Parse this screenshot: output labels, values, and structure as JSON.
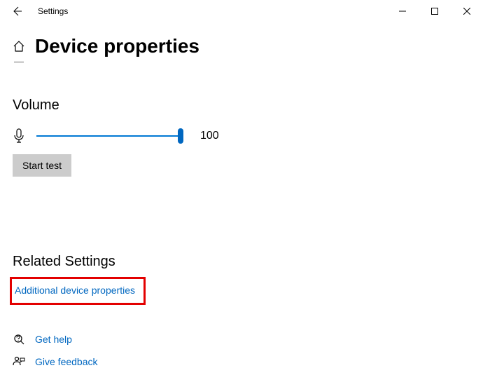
{
  "titlebar": {
    "app_title": "Settings"
  },
  "header": {
    "page_title": "Device properties"
  },
  "volume": {
    "section_title": "Volume",
    "value": "100",
    "start_test_label": "Start test"
  },
  "related": {
    "title": "Related Settings",
    "additional_device_link": "Additional device properties"
  },
  "help": {
    "get_help_label": "Get help",
    "give_feedback_label": "Give feedback"
  }
}
